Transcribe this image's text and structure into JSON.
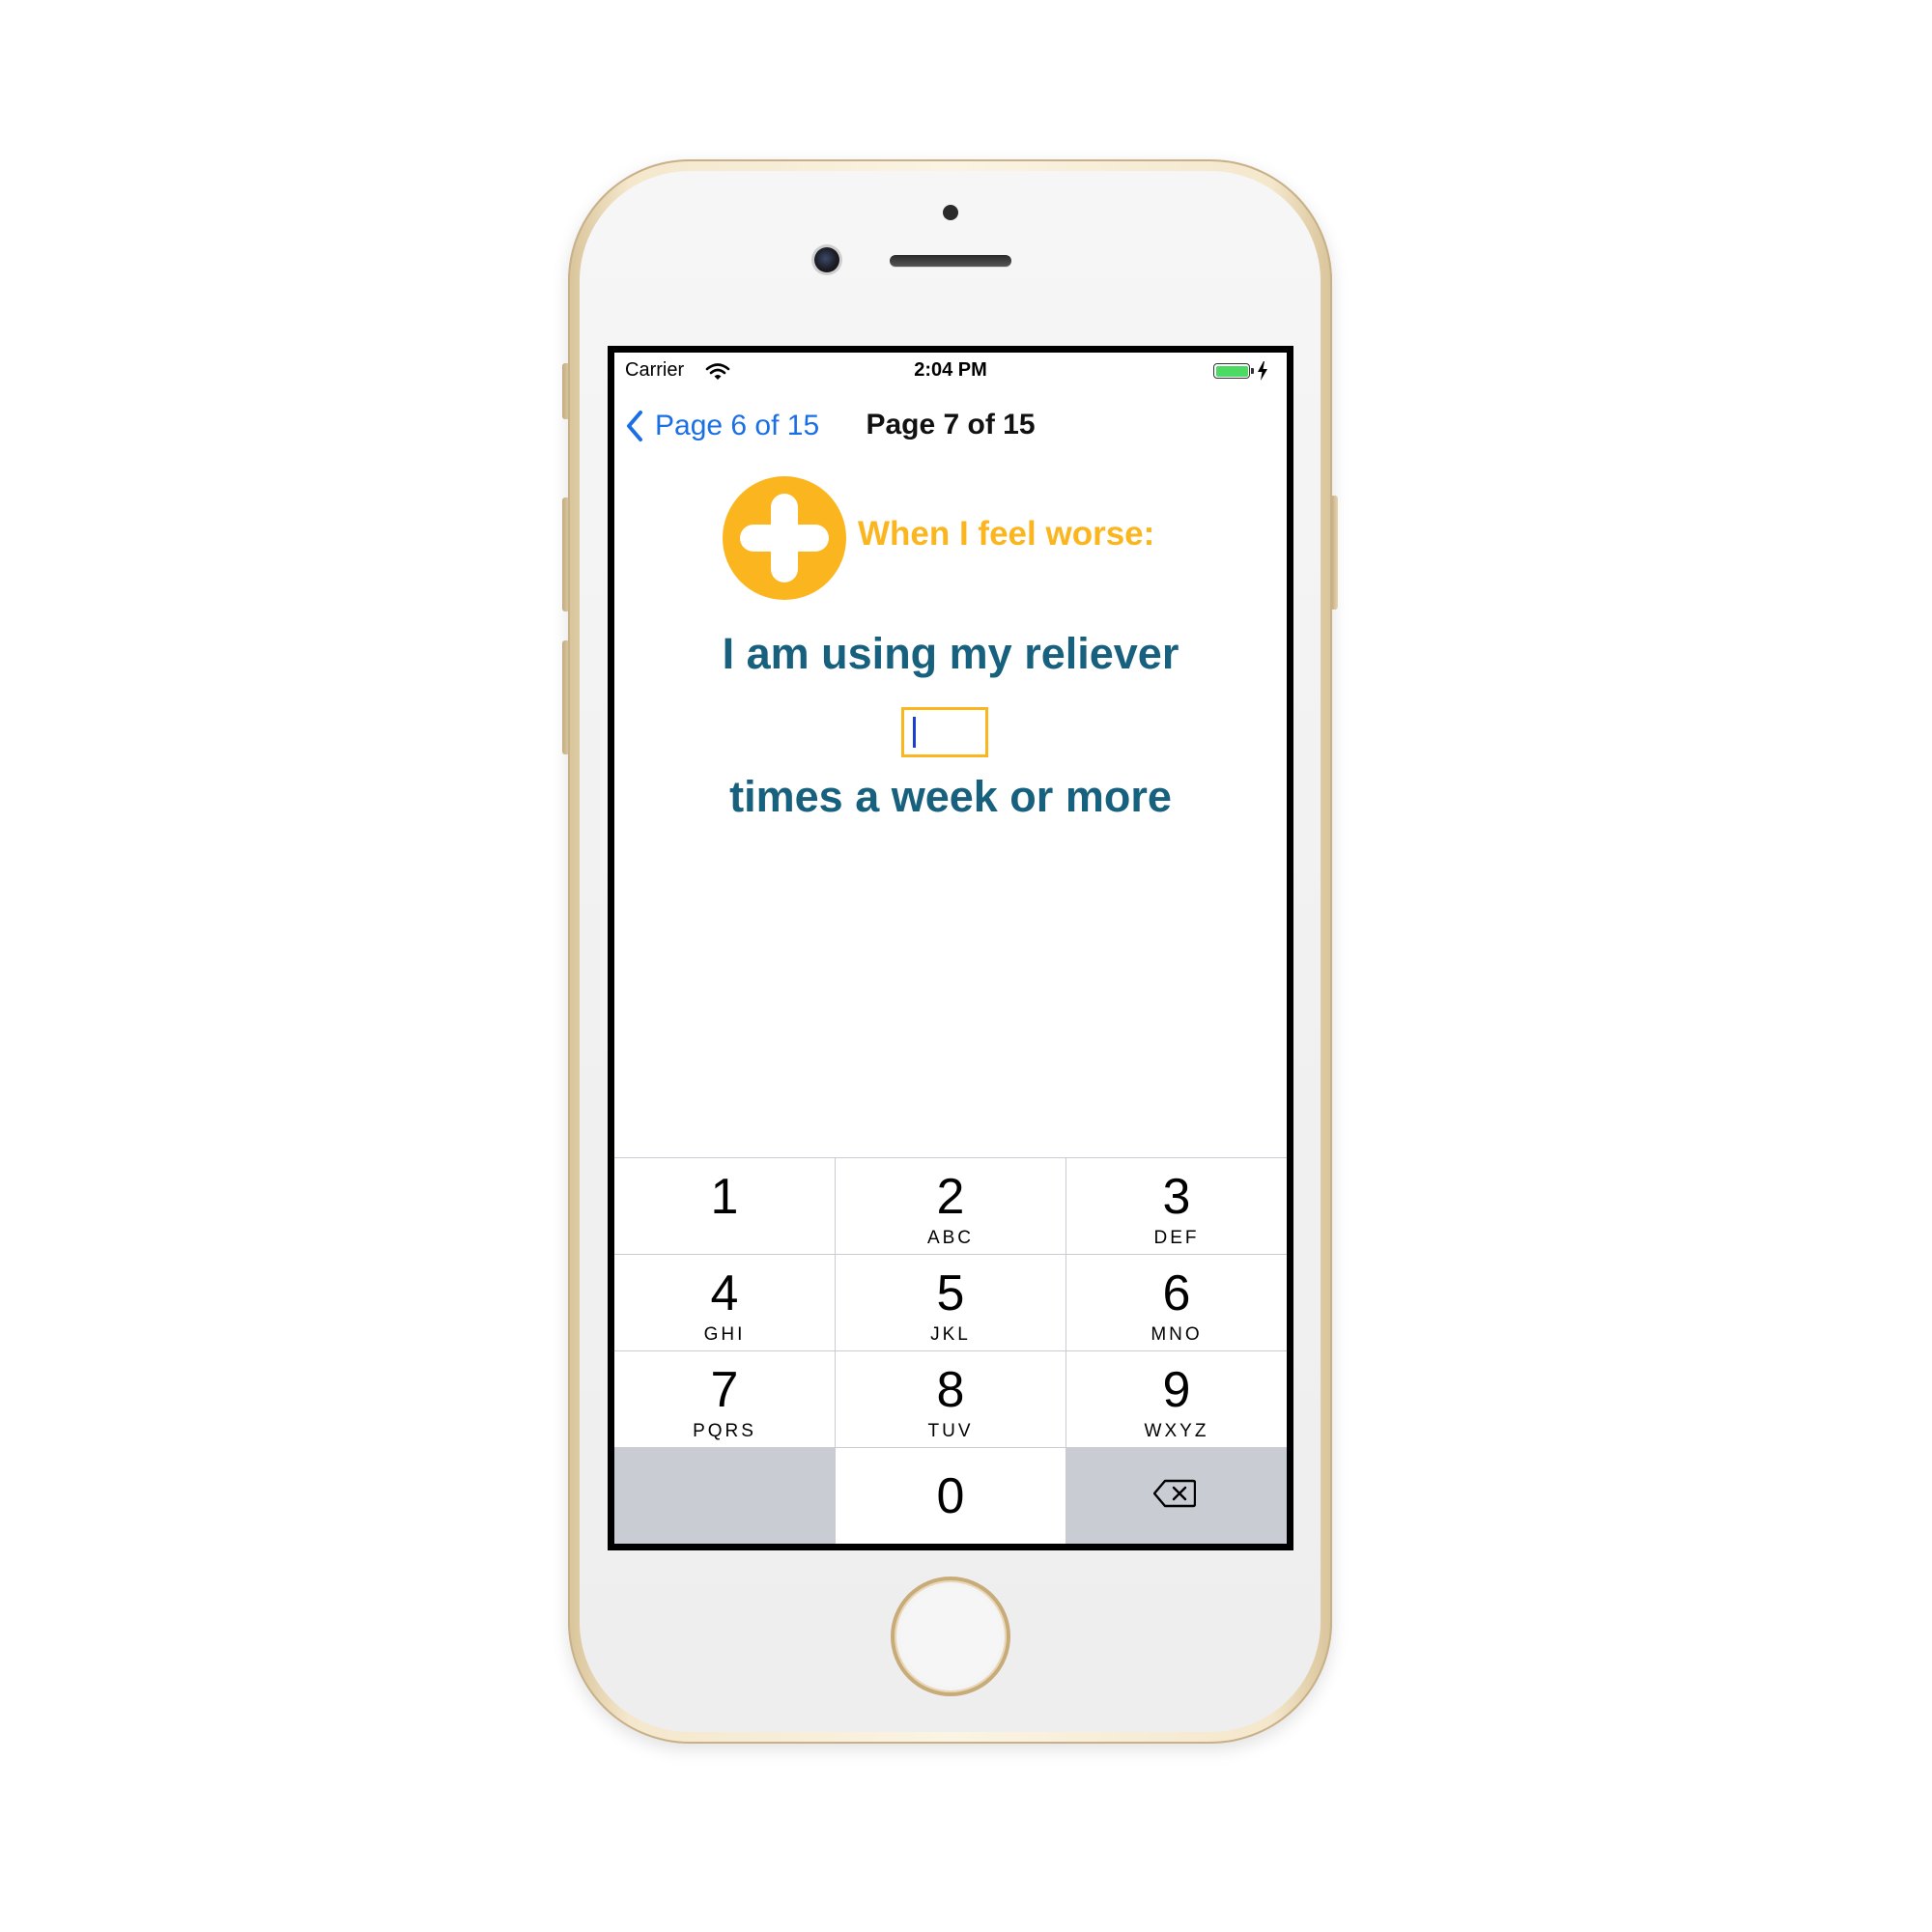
{
  "status_bar": {
    "carrier": "Carrier",
    "time": "2:04 PM",
    "battery_color": "#4cd964"
  },
  "nav": {
    "back_label": "Page 6 of 15",
    "title": "Page 7 of 15",
    "back_icon": "chevron-left-icon",
    "accent": "#1a6fe5"
  },
  "content": {
    "icon": "plus-circle-icon",
    "heading": "When I feel worse:",
    "line1": "I am using my reliever",
    "input_value": "",
    "line2": "times a week or more",
    "heading_color": "#fbb61f",
    "text_color": "#17607e"
  },
  "keypad": {
    "keys": [
      {
        "digit": "1",
        "letters": ""
      },
      {
        "digit": "2",
        "letters": "ABC"
      },
      {
        "digit": "3",
        "letters": "DEF"
      },
      {
        "digit": "4",
        "letters": "GHI"
      },
      {
        "digit": "5",
        "letters": "JKL"
      },
      {
        "digit": "6",
        "letters": "MNO"
      },
      {
        "digit": "7",
        "letters": "PQRS"
      },
      {
        "digit": "8",
        "letters": "TUV"
      },
      {
        "digit": "9",
        "letters": "WXYZ"
      }
    ],
    "zero": "0",
    "delete_icon": "delete-backspace-icon"
  }
}
